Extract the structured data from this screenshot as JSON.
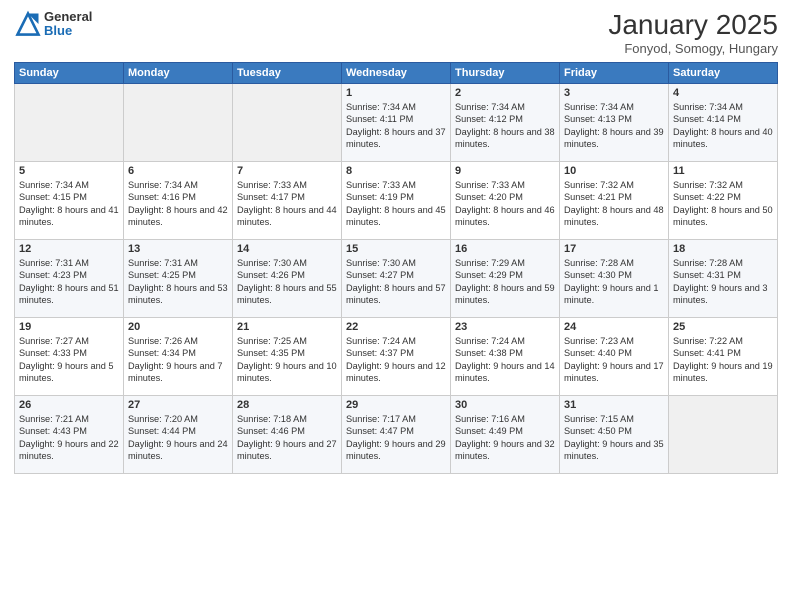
{
  "header": {
    "logo_general": "General",
    "logo_blue": "Blue",
    "month_title": "January 2025",
    "subtitle": "Fonyod, Somogy, Hungary"
  },
  "weekdays": [
    "Sunday",
    "Monday",
    "Tuesday",
    "Wednesday",
    "Thursday",
    "Friday",
    "Saturday"
  ],
  "weeks": [
    [
      {
        "day": "",
        "info": ""
      },
      {
        "day": "",
        "info": ""
      },
      {
        "day": "",
        "info": ""
      },
      {
        "day": "1",
        "info": "Sunrise: 7:34 AM\nSunset: 4:11 PM\nDaylight: 8 hours and 37 minutes."
      },
      {
        "day": "2",
        "info": "Sunrise: 7:34 AM\nSunset: 4:12 PM\nDaylight: 8 hours and 38 minutes."
      },
      {
        "day": "3",
        "info": "Sunrise: 7:34 AM\nSunset: 4:13 PM\nDaylight: 8 hours and 39 minutes."
      },
      {
        "day": "4",
        "info": "Sunrise: 7:34 AM\nSunset: 4:14 PM\nDaylight: 8 hours and 40 minutes."
      }
    ],
    [
      {
        "day": "5",
        "info": "Sunrise: 7:34 AM\nSunset: 4:15 PM\nDaylight: 8 hours and 41 minutes."
      },
      {
        "day": "6",
        "info": "Sunrise: 7:34 AM\nSunset: 4:16 PM\nDaylight: 8 hours and 42 minutes."
      },
      {
        "day": "7",
        "info": "Sunrise: 7:33 AM\nSunset: 4:17 PM\nDaylight: 8 hours and 44 minutes."
      },
      {
        "day": "8",
        "info": "Sunrise: 7:33 AM\nSunset: 4:19 PM\nDaylight: 8 hours and 45 minutes."
      },
      {
        "day": "9",
        "info": "Sunrise: 7:33 AM\nSunset: 4:20 PM\nDaylight: 8 hours and 46 minutes."
      },
      {
        "day": "10",
        "info": "Sunrise: 7:32 AM\nSunset: 4:21 PM\nDaylight: 8 hours and 48 minutes."
      },
      {
        "day": "11",
        "info": "Sunrise: 7:32 AM\nSunset: 4:22 PM\nDaylight: 8 hours and 50 minutes."
      }
    ],
    [
      {
        "day": "12",
        "info": "Sunrise: 7:31 AM\nSunset: 4:23 PM\nDaylight: 8 hours and 51 minutes."
      },
      {
        "day": "13",
        "info": "Sunrise: 7:31 AM\nSunset: 4:25 PM\nDaylight: 8 hours and 53 minutes."
      },
      {
        "day": "14",
        "info": "Sunrise: 7:30 AM\nSunset: 4:26 PM\nDaylight: 8 hours and 55 minutes."
      },
      {
        "day": "15",
        "info": "Sunrise: 7:30 AM\nSunset: 4:27 PM\nDaylight: 8 hours and 57 minutes."
      },
      {
        "day": "16",
        "info": "Sunrise: 7:29 AM\nSunset: 4:29 PM\nDaylight: 8 hours and 59 minutes."
      },
      {
        "day": "17",
        "info": "Sunrise: 7:28 AM\nSunset: 4:30 PM\nDaylight: 9 hours and 1 minute."
      },
      {
        "day": "18",
        "info": "Sunrise: 7:28 AM\nSunset: 4:31 PM\nDaylight: 9 hours and 3 minutes."
      }
    ],
    [
      {
        "day": "19",
        "info": "Sunrise: 7:27 AM\nSunset: 4:33 PM\nDaylight: 9 hours and 5 minutes."
      },
      {
        "day": "20",
        "info": "Sunrise: 7:26 AM\nSunset: 4:34 PM\nDaylight: 9 hours and 7 minutes."
      },
      {
        "day": "21",
        "info": "Sunrise: 7:25 AM\nSunset: 4:35 PM\nDaylight: 9 hours and 10 minutes."
      },
      {
        "day": "22",
        "info": "Sunrise: 7:24 AM\nSunset: 4:37 PM\nDaylight: 9 hours and 12 minutes."
      },
      {
        "day": "23",
        "info": "Sunrise: 7:24 AM\nSunset: 4:38 PM\nDaylight: 9 hours and 14 minutes."
      },
      {
        "day": "24",
        "info": "Sunrise: 7:23 AM\nSunset: 4:40 PM\nDaylight: 9 hours and 17 minutes."
      },
      {
        "day": "25",
        "info": "Sunrise: 7:22 AM\nSunset: 4:41 PM\nDaylight: 9 hours and 19 minutes."
      }
    ],
    [
      {
        "day": "26",
        "info": "Sunrise: 7:21 AM\nSunset: 4:43 PM\nDaylight: 9 hours and 22 minutes."
      },
      {
        "day": "27",
        "info": "Sunrise: 7:20 AM\nSunset: 4:44 PM\nDaylight: 9 hours and 24 minutes."
      },
      {
        "day": "28",
        "info": "Sunrise: 7:18 AM\nSunset: 4:46 PM\nDaylight: 9 hours and 27 minutes."
      },
      {
        "day": "29",
        "info": "Sunrise: 7:17 AM\nSunset: 4:47 PM\nDaylight: 9 hours and 29 minutes."
      },
      {
        "day": "30",
        "info": "Sunrise: 7:16 AM\nSunset: 4:49 PM\nDaylight: 9 hours and 32 minutes."
      },
      {
        "day": "31",
        "info": "Sunrise: 7:15 AM\nSunset: 4:50 PM\nDaylight: 9 hours and 35 minutes."
      },
      {
        "day": "",
        "info": ""
      }
    ]
  ]
}
